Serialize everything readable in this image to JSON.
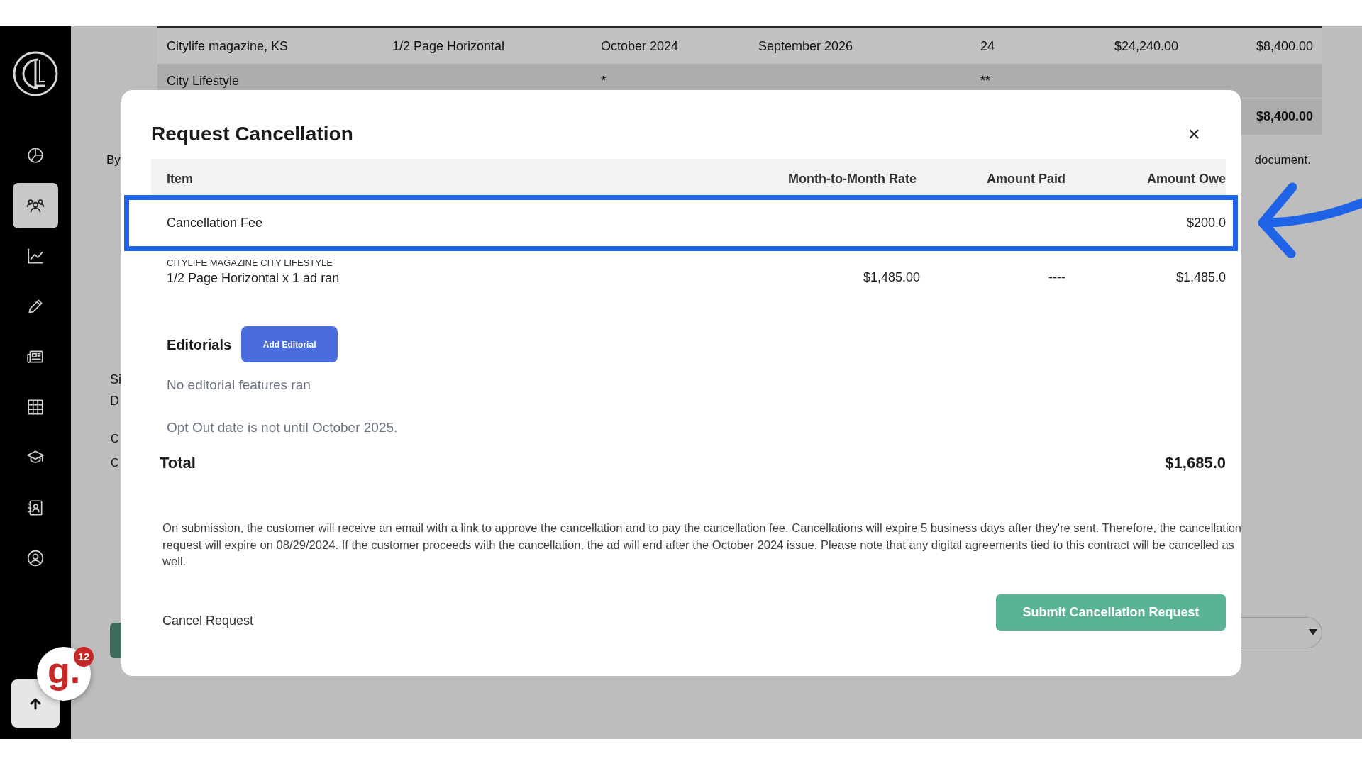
{
  "sidebar": {
    "items": [
      {
        "selected": false
      },
      {
        "selected": true
      },
      {
        "selected": false
      },
      {
        "selected": false
      },
      {
        "selected": false
      },
      {
        "selected": false
      },
      {
        "selected": false
      },
      {
        "selected": false
      },
      {
        "selected": false
      }
    ]
  },
  "background": {
    "table": {
      "rows": [
        {
          "column_1": "Citylife magazine, KS",
          "column_2": "1/2 Page Horizontal",
          "column_3": "October 2024",
          "column_4": "September 2026",
          "column_5": "24",
          "column_6": "$24,240.00",
          "column_7": "$8,400.00"
        },
        {
          "column_1": "City Lifestyle",
          "column_3": "*",
          "column_5": "**"
        }
      ],
      "total": "$8,400.00"
    },
    "peek_texts": {
      "left": "By",
      "right": "document.",
      "lines": [
        "Si",
        "D"
      ],
      "indented_lines": [
        "C",
        "C"
      ]
    }
  },
  "modal": {
    "title": "Request Cancellation",
    "close": "×",
    "columns": [
      "Item",
      "Month-to-Month Rate",
      "Amount Paid",
      "Amount Owe"
    ],
    "rows": [
      {
        "item": "Cancellation Fee",
        "amount_owed": "$200.0",
        "highlighted": true
      },
      {
        "category": "CITYLIFE MAGAZINE CITY LIFESTYLE",
        "item": "1/2 Page Horizontal x 1 ad ran",
        "rate": "$1,485.00",
        "amount_paid": "----",
        "amount_owed": "$1,485.0",
        "highlighted": false
      }
    ],
    "editorials": {
      "label": "Editorials",
      "button": "Add Editorial",
      "empty_text": "No editorial features ran"
    },
    "opt_out_note": "Opt Out date is not until October 2025.",
    "total": {
      "label": "Total",
      "value": "$1,685.0"
    },
    "notice": "On submission, the customer will receive an email with a link to approve the cancellation and to pay the cancellation fee. Cancellations will expire 5 business days after they're sent. Therefore, the cancellation request will expire on 08/29/2024. If the customer proceeds with the cancellation, the ad will end after the October 2024 issue. Please note that any digital agreements tied to this contract will be cancelled as well.",
    "cancel_link": "Cancel Request",
    "submit_button": "Submit Cancellation Request"
  },
  "help_widget": {
    "logo": "g.",
    "count": "12"
  }
}
